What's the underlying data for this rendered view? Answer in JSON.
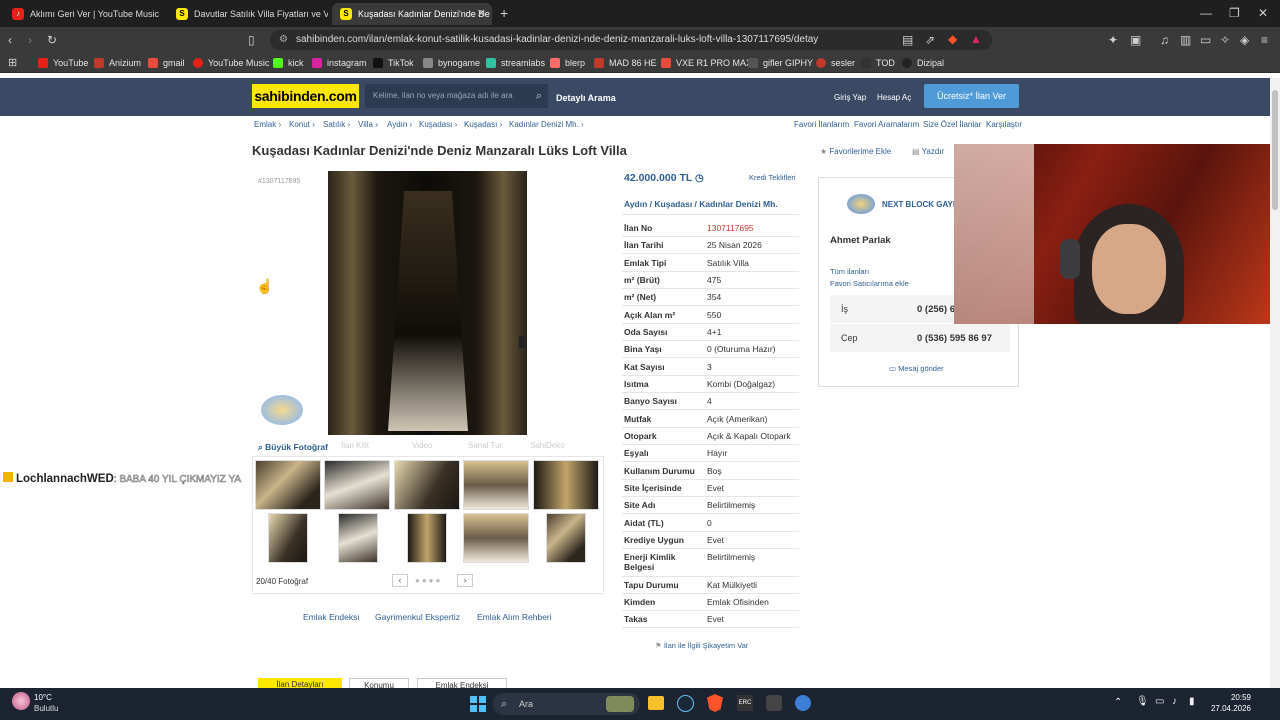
{
  "browser": {
    "tabs": [
      {
        "label": "Aklımı Geri Ver | YouTube Music",
        "fav_color": "#e62117"
      },
      {
        "label": "Davutlar Satılık Villa Fiyatları ve Villa",
        "fav_color": "#ffe800"
      },
      {
        "label": "Kuşadası Kadınlar Denizi'nde De",
        "fav_color": "#ffe800"
      }
    ],
    "url": "sahibinden.com/ilan/emlak-konut-satilik-kusadasi-kadinlar-denizi-nde-deniz-manzarali-luks-loft-villa-1307117695/detay",
    "bookmarks": [
      "YouTube",
      "Anizium",
      "gmail",
      "YouTube Music",
      "kick",
      "instagram",
      "TikTok",
      "bynogame",
      "streamlabs",
      "blerp",
      "MAD 86 HE",
      "VXE R1 PRO MAX",
      "gifler GIPHY",
      "sesler",
      "TOD",
      "Dizipal"
    ]
  },
  "site": {
    "logo": "sahibinden.com",
    "search_placeholder": "Kelime, ilan no veya mağaza adı ile ara",
    "detailed_search": "Detaylı Arama",
    "login": "Giriş Yap",
    "register": "Hesap Aç",
    "post_ad": "Ücretsiz* İlan Ver",
    "breadcrumb": [
      "Emlak",
      "Konut",
      "Satılık",
      "Villa",
      "Aydın",
      "Kuşadası",
      "Kuşadası",
      "Kadınlar Denizi Mh."
    ],
    "right_links": [
      "Favori İlanlarım",
      "Favori Aramalarım",
      "Size Özel İlanlar",
      "Karşılaştır"
    ]
  },
  "listing": {
    "title": "Kuşadası Kadınlar Denizi'nde Deniz Manzaralı Lüks Loft Villa",
    "id_tag": "#1307117695",
    "favorite": "Favorilerime Ekle",
    "print": "Yazdır",
    "price": "42.000.000 TL",
    "credit": "Kredi Teklifleri",
    "location": [
      "Aydın",
      "Kuşadası",
      "Kadınlar Denizi Mh."
    ],
    "big_photo": "Büyük Fotoğraf",
    "gallery_tabs": [
      "İlan Kilit",
      "Video",
      "Sanal Tur",
      "SahiDeko"
    ],
    "photo_count": "20/40 Fotoğraf",
    "links": [
      "Emlak Endeksi",
      "Gayrimenkul Ekspertiz",
      "Emlak Alım Rehberi"
    ],
    "complaint": "İlan ile İlgili Şikayetim Var",
    "bottom_tabs": [
      "İlan Detayları",
      "Konumu",
      "Emlak Endeksi"
    ],
    "specs": [
      {
        "k": "İlan No",
        "v": "1307117695"
      },
      {
        "k": "İlan Tarihi",
        "v": "25 Nisan 2026"
      },
      {
        "k": "Emlak Tipi",
        "v": "Satılık Villa"
      },
      {
        "k": "m² (Brüt)",
        "v": "475"
      },
      {
        "k": "m² (Net)",
        "v": "354"
      },
      {
        "k": "Açık Alan m²",
        "v": "550"
      },
      {
        "k": "Oda Sayısı",
        "v": "4+1"
      },
      {
        "k": "Bina Yaşı",
        "v": "0 (Oturuma Hazır)"
      },
      {
        "k": "Kat Sayısı",
        "v": "3"
      },
      {
        "k": "Isıtma",
        "v": "Kombi (Doğalgaz)"
      },
      {
        "k": "Banyo Sayısı",
        "v": "4"
      },
      {
        "k": "Mutfak",
        "v": "Açık (Amerikan)"
      },
      {
        "k": "Otopark",
        "v": "Açık & Kapalı Otopark"
      },
      {
        "k": "Eşyalı",
        "v": "Hayır"
      },
      {
        "k": "Kullanım Durumu",
        "v": "Boş"
      },
      {
        "k": "Site İçerisinde",
        "v": "Evet"
      },
      {
        "k": "Site Adı",
        "v": "Belirtilmemiş"
      },
      {
        "k": "Aidat (TL)",
        "v": "0"
      },
      {
        "k": "Krediye Uygun",
        "v": "Evet"
      },
      {
        "k": "Enerji Kimlik Belgesi",
        "v": "Belirtilmemiş"
      },
      {
        "k": "Tapu Durumu",
        "v": "Kat Mülkiyetli"
      },
      {
        "k": "Kimden",
        "v": "Emlak Ofisinden"
      },
      {
        "k": "Takas",
        "v": "Evet"
      }
    ]
  },
  "seller": {
    "company": "NEXT BLOCK GAYR",
    "name": "Ahmet Parlak",
    "all_ads": "Tüm ilanları",
    "fav_seller": "Favori Satıcılarıma ekle",
    "work_label": "İş",
    "work_phone": "0 (256) 6",
    "cell_label": "Cep",
    "cell_phone": "0 (536) 595 86 97",
    "message": "Mesaj gönder"
  },
  "overlay": {
    "chat_user": "LochlannachWED",
    "chat_msg": ": BABA 40 YIL ÇIKMAYIZ YA"
  },
  "taskbar": {
    "temp": "10°C",
    "weather": "Bulutlu",
    "search": "Ara",
    "time": "20:59",
    "date": "27.04.2026"
  }
}
